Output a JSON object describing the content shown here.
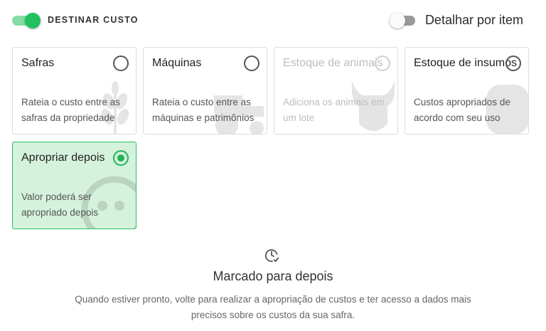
{
  "header": {
    "destinar_label": "DESTINAR CUSTO",
    "destinar_on": true,
    "detalhar_label": "Detalhar por item",
    "detalhar_on": false
  },
  "cards": [
    {
      "title": "Safras",
      "desc": "Rateia o custo entre as safras da propriedade",
      "state": "enabled",
      "watermark_icon": "wheat-icon"
    },
    {
      "title": "Máquinas",
      "desc": "Rateia o custo entre as máquinas e patrimônios",
      "state": "enabled",
      "watermark_icon": "tractor-icon"
    },
    {
      "title": "Estoque de animais",
      "desc": "Adiciona os animais em um lote",
      "state": "disabled",
      "watermark_icon": "cow-icon"
    },
    {
      "title": "Estoque de insumos",
      "desc": "Custos apropriados de acordo com seu uso",
      "state": "enabled",
      "watermark_icon": "box-icon"
    },
    {
      "title": "Apropriar depois",
      "desc": "Valor poderá ser apropriado depois",
      "state": "selected",
      "watermark_icon": "clock-later-icon"
    }
  ],
  "info": {
    "icon": "clock-check-icon",
    "title": "Marcado para depois",
    "text": "Quando estiver pronto, volte para realizar a apropriação de custos e ter acesso a dados mais precisos sobre os custos da sua safra."
  },
  "colors": {
    "accent": "#22c05f",
    "selected_bg": "#d5f2dd"
  }
}
